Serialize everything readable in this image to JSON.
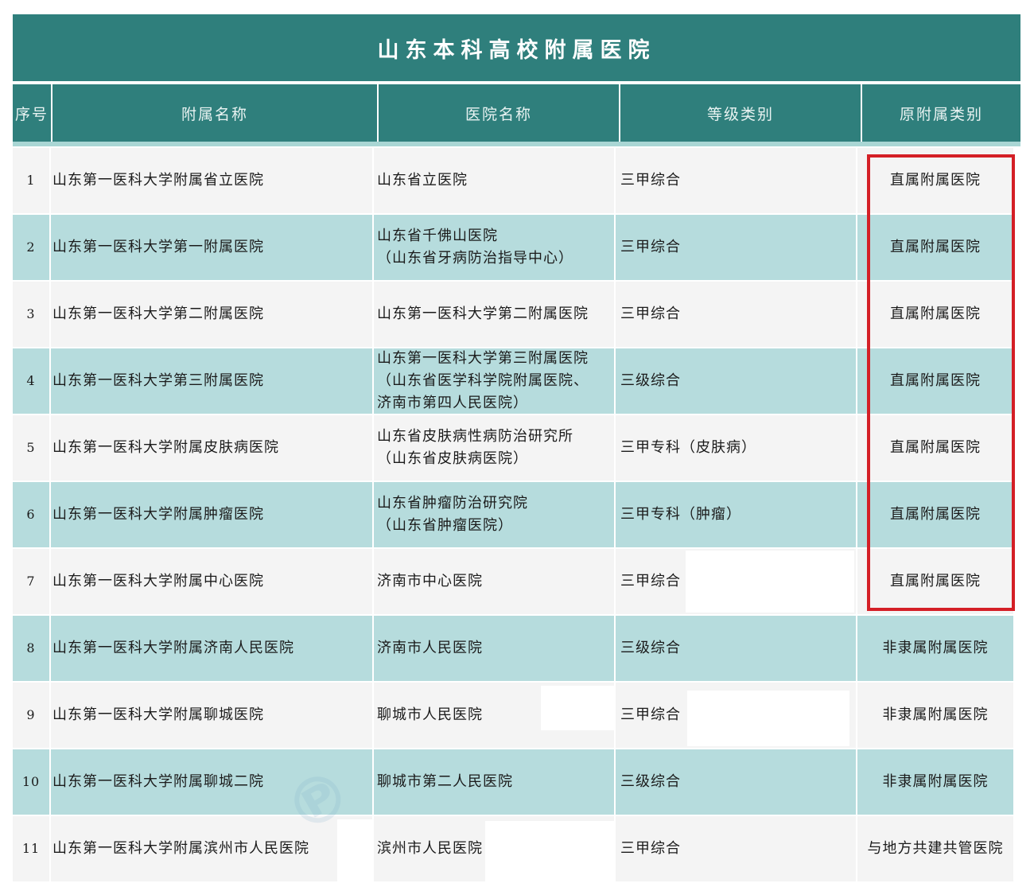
{
  "title": "山东本科高校附属医院",
  "headers": {
    "index": "序号",
    "affiliate_name": "附属名称",
    "hospital_name": "医院名称",
    "grade": "等级类别",
    "original_type": "原附属类别"
  },
  "rows": [
    {
      "index": "1",
      "affiliate_name": "山东第一医科大学附属省立医院",
      "hospital_name": [
        "山东省立医院"
      ],
      "grade": "三甲综合",
      "original_type": "直属附属医院"
    },
    {
      "index": "2",
      "affiliate_name": "山东第一医科大学第一附属医院",
      "hospital_name": [
        "山东省千佛山医院",
        "（山东省牙病防治指导中心）"
      ],
      "grade": "三甲综合",
      "original_type": "直属附属医院"
    },
    {
      "index": "3",
      "affiliate_name": "山东第一医科大学第二附属医院",
      "hospital_name": [
        "山东第一医科大学第二附属医院"
      ],
      "grade": "三甲综合",
      "original_type": "直属附属医院"
    },
    {
      "index": "4",
      "affiliate_name": "山东第一医科大学第三附属医院",
      "hospital_name": [
        "山东第一医科大学第三附属医院",
        "（山东省医学科学院附属医院、",
        "济南市第四人民医院）"
      ],
      "grade": "三级综合",
      "original_type": "直属附属医院"
    },
    {
      "index": "5",
      "affiliate_name": "山东第一医科大学附属皮肤病医院",
      "hospital_name": [
        "山东省皮肤病性病防治研究所",
        "（山东省皮肤病医院）"
      ],
      "grade": "三甲专科（皮肤病）",
      "original_type": "直属附属医院"
    },
    {
      "index": "6",
      "affiliate_name": "山东第一医科大学附属肿瘤医院",
      "hospital_name": [
        "山东省肿瘤防治研究院",
        "（山东省肿瘤医院）"
      ],
      "grade": "三甲专科（肿瘤）",
      "original_type": "直属附属医院"
    },
    {
      "index": "7",
      "affiliate_name": "山东第一医科大学附属中心医院",
      "hospital_name": [
        "济南市中心医院"
      ],
      "grade": "三甲综合",
      "original_type": "直属附属医院"
    },
    {
      "index": "8",
      "affiliate_name": "山东第一医科大学附属济南人民医院",
      "hospital_name": [
        "济南市人民医院"
      ],
      "grade": "三级综合",
      "original_type": "非隶属附属医院"
    },
    {
      "index": "9",
      "affiliate_name": "山东第一医科大学附属聊城医院",
      "hospital_name": [
        "聊城市人民医院"
      ],
      "grade": "三甲综合",
      "original_type": "非隶属附属医院"
    },
    {
      "index": "10",
      "affiliate_name": "山东第一医科大学附属聊城二院",
      "hospital_name": [
        "聊城市第二人民医院"
      ],
      "grade": "三级综合",
      "original_type": "非隶属附属医院"
    },
    {
      "index": "11",
      "affiliate_name": "山东第一医科大学附属滨州市人民医院",
      "hospital_name": [
        "滨州市人民医院"
      ],
      "grade": "三甲综合",
      "original_type": "与地方共建共管医院"
    }
  ],
  "colors": {
    "header_bg": "#2f7f7c",
    "row_light": "#f4f4f4",
    "row_teal": "#b6dcdd",
    "highlight_border": "#d41f26"
  }
}
